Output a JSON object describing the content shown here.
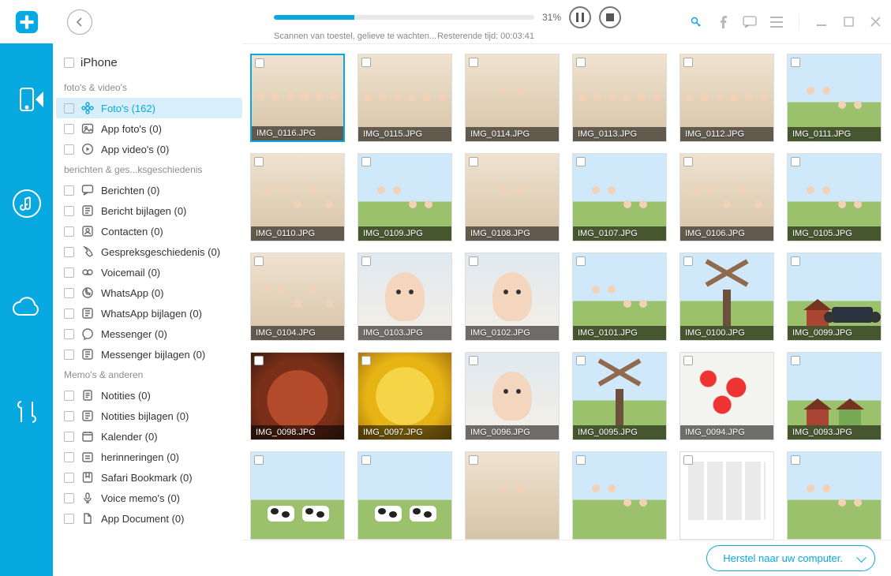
{
  "progress": {
    "percent": "31%",
    "fill_pct": 31,
    "scan_text": "Scannen van toestel, gelieve te wachten...",
    "remaining": "Resterende tijd: 00:03:41"
  },
  "device": {
    "name": "iPhone"
  },
  "groups": [
    {
      "label": "foto's & video's",
      "items": [
        {
          "id": "photos",
          "label": "Foto's (162)",
          "selected": true,
          "icon": "flower"
        },
        {
          "id": "app-photos",
          "label": "App foto's (0)",
          "icon": "image"
        },
        {
          "id": "app-videos",
          "label": "App video's (0)",
          "icon": "play"
        }
      ]
    },
    {
      "label": "berichten & ges...ksgeschiedenis",
      "items": [
        {
          "id": "messages",
          "label": "Berichten (0)",
          "icon": "chat"
        },
        {
          "id": "msg-attach",
          "label": "Bericht bijlagen (0)",
          "icon": "attach"
        },
        {
          "id": "contacts",
          "label": "Contacten (0)",
          "icon": "contact"
        },
        {
          "id": "callhist",
          "label": "Gespreksgeschiedenis (0)",
          "icon": "phone"
        },
        {
          "id": "voicemail",
          "label": "Voicemail (0)",
          "icon": "voicemail"
        },
        {
          "id": "whatsapp",
          "label": "WhatsApp (0)",
          "icon": "whatsapp"
        },
        {
          "id": "wa-attach",
          "label": "WhatsApp bijlagen (0)",
          "icon": "attach"
        },
        {
          "id": "messenger",
          "label": "Messenger (0)",
          "icon": "messenger"
        },
        {
          "id": "msgr-attach",
          "label": "Messenger bijlagen (0)",
          "icon": "attach"
        }
      ]
    },
    {
      "label": "Memo's & anderen",
      "items": [
        {
          "id": "notes",
          "label": "Notities (0)",
          "icon": "note"
        },
        {
          "id": "notes-attach",
          "label": "Notities bijlagen (0)",
          "icon": "attach"
        },
        {
          "id": "calendar",
          "label": "Kalender (0)",
          "icon": "calendar"
        },
        {
          "id": "reminders",
          "label": "herinneringen (0)",
          "icon": "reminder"
        },
        {
          "id": "safari",
          "label": "Safari Bookmark (0)",
          "icon": "bookmark"
        },
        {
          "id": "voicememo",
          "label": "Voice memo's (0)",
          "icon": "mic"
        },
        {
          "id": "appdoc",
          "label": "App Document (0)",
          "icon": "doc"
        }
      ]
    }
  ],
  "thumbnails": [
    {
      "file": "IMG_0116.JPG",
      "kind": "bridesmaids",
      "selected": true
    },
    {
      "file": "IMG_0115.JPG",
      "kind": "bridesmaids"
    },
    {
      "file": "IMG_0114.JPG",
      "kind": "wedding-couple"
    },
    {
      "file": "IMG_0113.JPG",
      "kind": "bridesmaids"
    },
    {
      "file": "IMG_0112.JPG",
      "kind": "bridesmaids"
    },
    {
      "file": "IMG_0111.JPG",
      "kind": "family-outdoor"
    },
    {
      "file": "IMG_0110.JPG",
      "kind": "family-floor"
    },
    {
      "file": "IMG_0109.JPG",
      "kind": "family-outdoor"
    },
    {
      "file": "IMG_0108.JPG",
      "kind": "wedding-couple"
    },
    {
      "file": "IMG_0107.JPG",
      "kind": "family-outdoor"
    },
    {
      "file": "IMG_0106.JPG",
      "kind": "family-indoor"
    },
    {
      "file": "IMG_0105.JPG",
      "kind": "family-outdoor"
    },
    {
      "file": "IMG_0104.JPG",
      "kind": "family-dinner"
    },
    {
      "file": "IMG_0103.JPG",
      "kind": "portrait-girl"
    },
    {
      "file": "IMG_0102.JPG",
      "kind": "portrait-girl"
    },
    {
      "file": "IMG_0101.JPG",
      "kind": "family-outdoor"
    },
    {
      "file": "IMG_0100.JPG",
      "kind": "windmill-scene"
    },
    {
      "file": "IMG_0099.JPG",
      "kind": "car-scene"
    },
    {
      "file": "IMG_0098.JPG",
      "kind": "food-meat"
    },
    {
      "file": "IMG_0097.JPG",
      "kind": "food-pineapple"
    },
    {
      "file": "IMG_0096.JPG",
      "kind": "portrait-girl"
    },
    {
      "file": "IMG_0095.JPG",
      "kind": "windmill-scene"
    },
    {
      "file": "IMG_0094.JPG",
      "kind": "flowers"
    },
    {
      "file": "IMG_0093.JPG",
      "kind": "houses"
    },
    {
      "file": "",
      "kind": "cows"
    },
    {
      "file": "",
      "kind": "cows"
    },
    {
      "file": "",
      "kind": "wedding-couple"
    },
    {
      "file": "",
      "kind": "family-outdoor"
    },
    {
      "file": "",
      "kind": "screenshots"
    },
    {
      "file": "",
      "kind": "family-outdoor"
    }
  ],
  "footer": {
    "restore_label": "Herstel naar uw computer."
  }
}
